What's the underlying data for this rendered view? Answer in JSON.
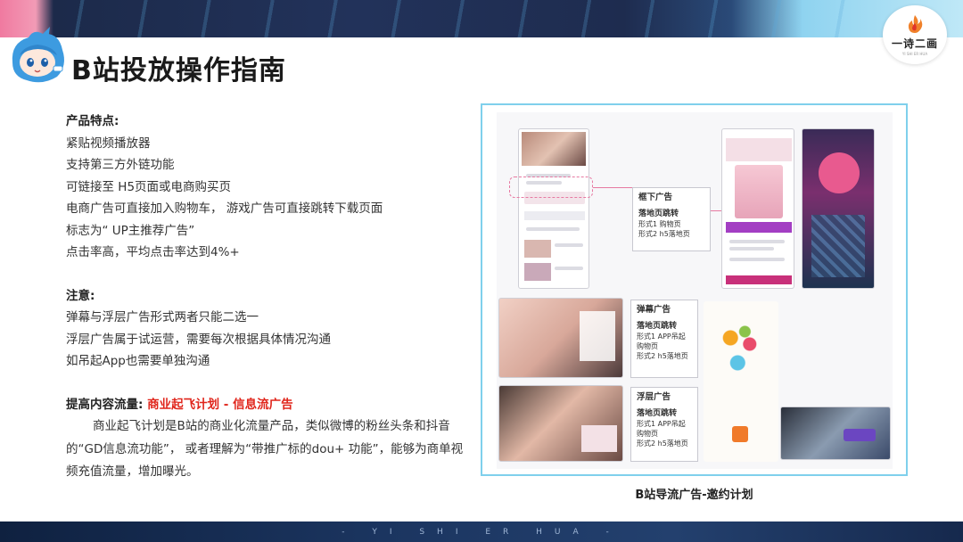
{
  "header": {
    "title": "B站投放操作指南",
    "logo_text": "一诗二画",
    "logo_sub": "YI SHI ER HUA"
  },
  "features": {
    "title": "产品特点:",
    "items": [
      "紧贴视频播放器",
      "支持第三方外链功能",
      "可链接至 H5页面或电商购买页",
      "电商广告可直接加入购物车， 游戏广告可直接跳转下载页面",
      "标志为“ UP主推荐广告”",
      "点击率高，平均点击率达到4%+"
    ]
  },
  "notes": {
    "title": "注意:",
    "items": [
      "弹幕与浮层广告形式两者只能二选一",
      "浮层广告属于试运营，需要每次根据具体情况沟通",
      "如吊起App也需要单独沟通"
    ]
  },
  "boost": {
    "label": "提高内容流量:",
    "highlight": "商业起飞计划 - 信息流广告",
    "paragraph": "商业起飞计划是B站的商业化流量产品，类似微博的粉丝头条和抖音的“GD信息流功能”， 或者理解为“带推广标的dou+ 功能”，能够为商单视频充值流量，增加曝光。"
  },
  "figure": {
    "caption": "B站导流广告-邀约计划",
    "boxes": [
      {
        "title": "框下广告",
        "sub": "落地页跳转",
        "lines": [
          "形式1 购物页",
          "形式2 h5落地页"
        ]
      },
      {
        "title": "弹幕广告",
        "sub": "落地页跳转",
        "lines": [
          "形式1 APP吊起购物页",
          "形式2 h5落地页"
        ]
      },
      {
        "title": "浮层广告",
        "sub": "落地页跳转",
        "lines": [
          "形式1 APP吊起购物页",
          "形式2 h5落地页"
        ]
      }
    ]
  },
  "footer": {
    "text": "- YI SHI ER HUA -"
  },
  "colors": {
    "accent_red": "#e0251b",
    "frame_blue": "#7fd0ec",
    "pink": "#e77aa2"
  }
}
